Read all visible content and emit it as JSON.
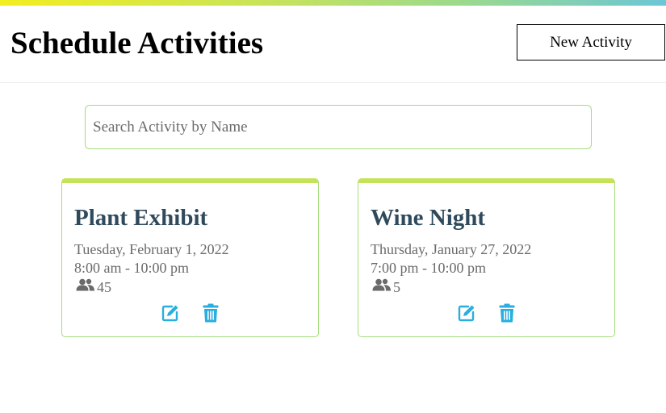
{
  "colors": {
    "accent": "#c5e35a",
    "border": "#a5dc7d",
    "icon": "#29aee0",
    "title": "#2f4a5c"
  },
  "header": {
    "title": "Schedule Activities",
    "new_button_label": "New Activity"
  },
  "search": {
    "placeholder": "Search Activity by Name",
    "value": ""
  },
  "activities": [
    {
      "name": "Plant Exhibit",
      "date": "Tuesday, February 1, 2022",
      "time": "8:00 am - 10:00 pm",
      "attendees": "45",
      "icons": {
        "people": "people-icon",
        "edit": "edit-icon",
        "delete": "trash-icon"
      }
    },
    {
      "name": "Wine Night",
      "date": "Thursday, January 27, 2022",
      "time": "7:00 pm - 10:00 pm",
      "attendees": "5",
      "icons": {
        "people": "people-icon",
        "edit": "edit-icon",
        "delete": "trash-icon"
      }
    }
  ]
}
